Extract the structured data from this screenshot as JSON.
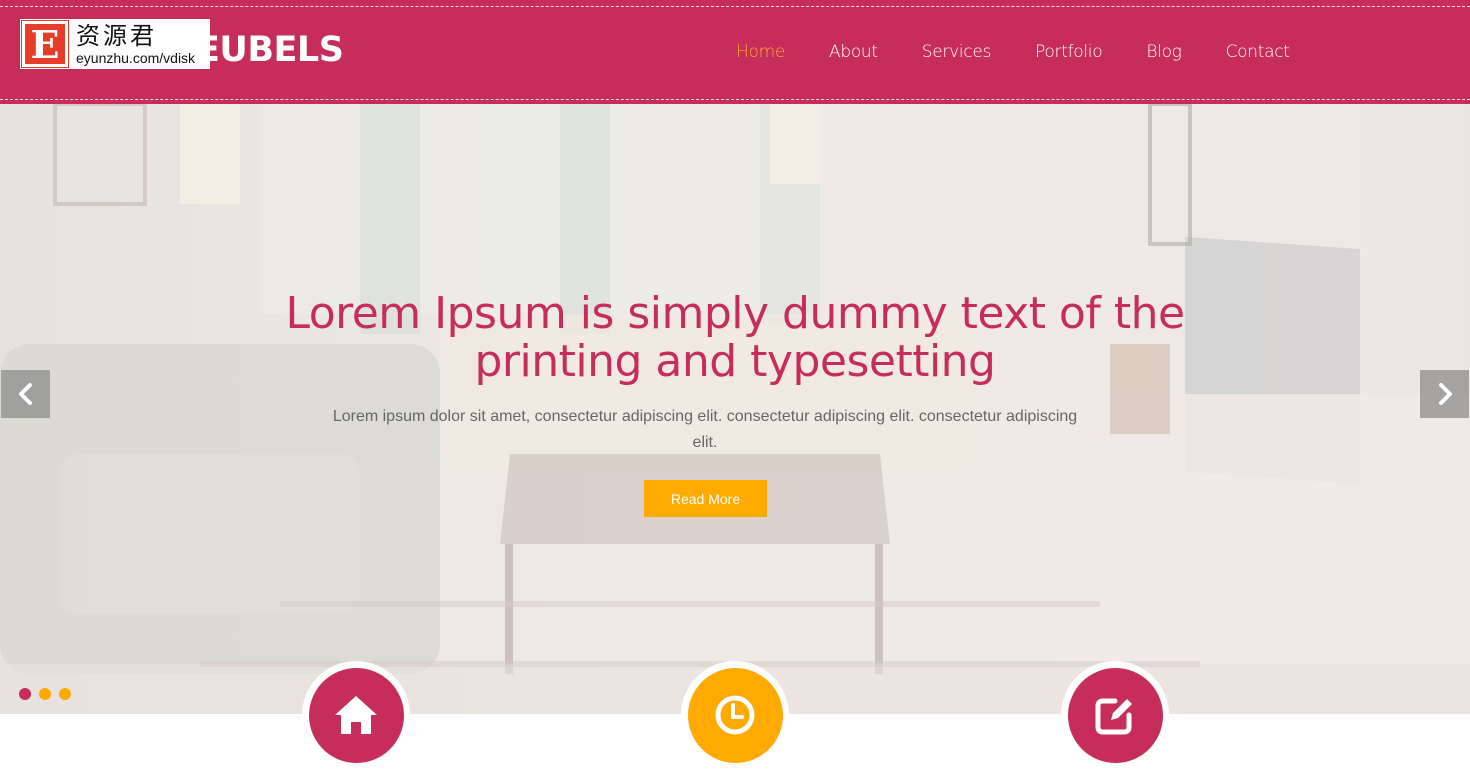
{
  "header": {
    "logo": "EUBELS",
    "watermark": {
      "letter": "E",
      "chinese": "资源君",
      "url": "eyunzhu.com/vdisk"
    },
    "nav": [
      {
        "label": "Home",
        "active": true
      },
      {
        "label": "About",
        "active": false
      },
      {
        "label": "Services",
        "active": false
      },
      {
        "label": "Portfolio",
        "active": false
      },
      {
        "label": "Blog",
        "active": false
      },
      {
        "label": "Contact",
        "active": false
      }
    ]
  },
  "hero": {
    "title": "Lorem Ipsum is simply dummy text of the printing and typesetting",
    "subtitle": "Lorem ipsum dolor sit amet, consectetur adipiscing elit. consectetur adipiscing elit. consectetur adipiscing elit.",
    "button_label": "Read More",
    "prev_icon": "chevron-left-icon",
    "next_icon": "chevron-right-icon",
    "slide_count": 3,
    "active_slide": 1
  },
  "features": [
    {
      "icon": "home-icon",
      "color": "#c72d5a"
    },
    {
      "icon": "clock-icon",
      "color": "#ffaa00"
    },
    {
      "icon": "edit-icon",
      "color": "#c72d5a"
    }
  ],
  "colors": {
    "brand": "#c72d5a",
    "accent": "#ffaa00",
    "nav_active": "#ffaa33"
  }
}
